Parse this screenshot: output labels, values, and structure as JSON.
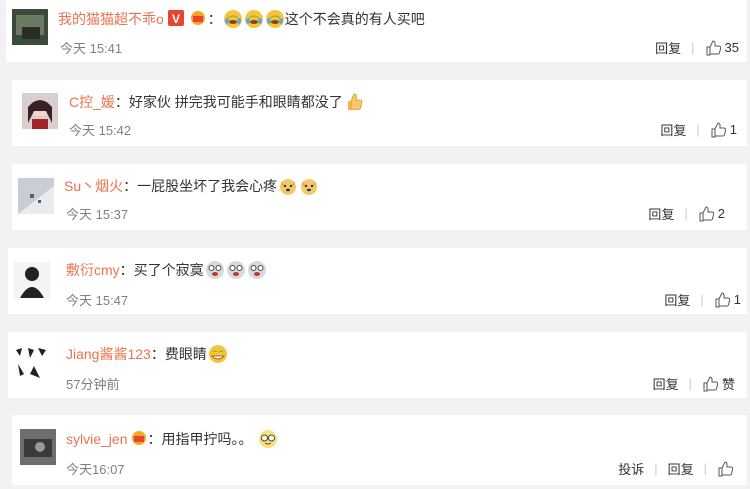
{
  "comments": [
    {
      "username": "我的猫猫超不乖o",
      "text": "这个不会真的有人买吧",
      "time": "今天 15:41",
      "reply": "回复",
      "likes": "35"
    },
    {
      "username": "C控_媛",
      "text": "好家伙 拼完我可能手和眼睛都没了",
      "time": "今天 15:42",
      "reply": "回复",
      "likes": "1"
    },
    {
      "username": "Su丶烟火",
      "text": "一屁股坐坏了我会心疼",
      "time": "今天 15:37",
      "reply": "回复",
      "likes": "2"
    },
    {
      "username": "敷衍cmy",
      "text": "买了个寂寞",
      "time": "今天 15:47",
      "reply": "回复",
      "likes": "1"
    },
    {
      "username": "Jiang酱酱123",
      "text": "费眼睛",
      "time": "57分钟前",
      "reply": "回复",
      "likes": "赞"
    },
    {
      "username": "sylvie_jen",
      "text": "用指甲拧吗。。",
      "time": "今天16:07",
      "report": "投诉",
      "reply": "回复"
    }
  ],
  "colon": "：",
  "colors": {
    "username": "#eb7350",
    "time": "#808080",
    "background": "#f2f2f5"
  }
}
